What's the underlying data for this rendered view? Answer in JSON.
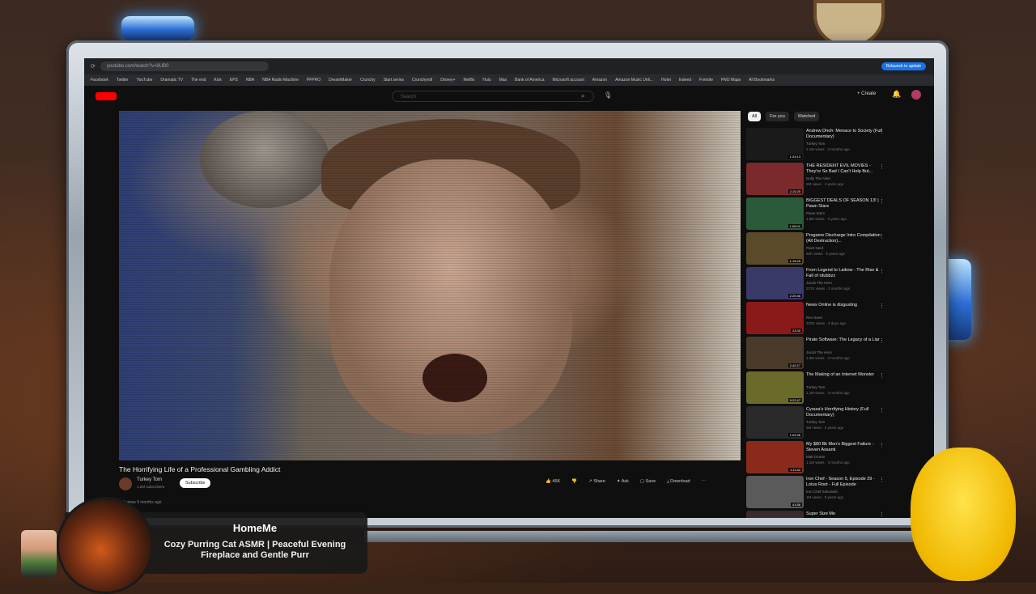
{
  "browser": {
    "url": "youtube.com/watch?v=8UB0",
    "relaunch_label": "Relaunch to update",
    "bookmarks": [
      "Facebook",
      "Twitter",
      "YouTube",
      "Dramatic TV",
      "The end",
      "Kick",
      "EPS",
      "NBA",
      "NBA Radio Machine",
      "PFPRO",
      "DreamMaker",
      "Crunchy",
      "Start series",
      "Crunchyroll",
      "Disney+",
      "Netflix",
      "Hulu",
      "Max",
      "Bank of America",
      "Microsoft account",
      "Amazon",
      "Amazon Music Unli...",
      "Hotel",
      "Indeed",
      "Fortnite",
      "FNO Maps",
      "All Bookmarks"
    ]
  },
  "youtube": {
    "search_placeholder": "Search",
    "create_label": "Create",
    "chips": [
      "All",
      "For you",
      "Watched"
    ],
    "video": {
      "title": "The Horrifying Life of a Professional Gambling Addict",
      "channel": "Turkey Tom",
      "subscribers": "1.2M subscribers",
      "subscribe_label": "Subscribe",
      "likes": "46K",
      "share_label": "Share",
      "ask_label": "Ask",
      "save_label": "Save",
      "download_label": "Download",
      "meta": "1M views  9 months ago"
    },
    "recommendations": [
      {
        "title": "Andrew Dhoh: Menace to Society (Full Documentary)",
        "channel": "Turkey Tom",
        "meta": "2.1M views · 3 months ago",
        "duration": "1:24:13",
        "color": "#1a1a1a"
      },
      {
        "title": "THE RESIDENT EVIL MOVIES - They're So Bad I Can't Help But...",
        "channel": "Dolly The Alien",
        "meta": "2M views · 4 years ago",
        "duration": "2:10:25",
        "color": "#7a2a2a"
      },
      {
        "title": "BIGGEST DEALS OF SEASON 13! | Pawn Stars",
        "channel": "Pawn Stars",
        "meta": "1.8M views · 3 years ago",
        "duration": "1:05:01",
        "color": "#2a5a3a"
      },
      {
        "title": "Progame Discharge Intro Compilation (All Destruction)...",
        "channel": "Paint Nerd",
        "meta": "50K views · 5 years ago",
        "duration": "1:15:25",
        "color": "#5a4a2a"
      },
      {
        "title": "From Legend to Laikow - The Rise & Fall of rdubbzz",
        "channel": "Jacob The Hero",
        "meta": "227K views · 2 months ago",
        "duration": "2:20:46",
        "color": "#3a3a6a"
      },
      {
        "title": "News Online is disgusting",
        "channel": "Rev Seed",
        "meta": "220K views · 3 days ago",
        "duration": "23:30",
        "color": "#8a1a1a"
      },
      {
        "title": "Pirate Software: The Legacy of a Liar",
        "channel": "Jacob The Hero",
        "meta": "1.8M views · 4 months ago",
        "duration": "2:42:27",
        "color": "#4a3a2a"
      },
      {
        "title": "The Making of an Internet Monster",
        "channel": "Turkey Tom",
        "meta": "1.1M views · 3 months ago",
        "duration": "5:22:47",
        "color": "#6a6a2a"
      },
      {
        "title": "Cyrasa's Horrifying History (Full Documentary)",
        "channel": "Turkey Tom",
        "meta": "3M views · 2 years ago",
        "duration": "1:09:36",
        "color": "#2a2a2a"
      },
      {
        "title": "My $80 Bk Men's Biggest Failure - Steven Assanti",
        "channel": "Matt Ocean",
        "meta": "1.1M views · 3 months ago",
        "duration": "1:11:52",
        "color": "#8a2a1a"
      },
      {
        "title": "Iron Chef - Season 5, Episode 29 - Lotus Root - Full Episode",
        "channel": "Iron Chef Sokowski",
        "meta": "1M views · 5 years ago",
        "duration": "41:56",
        "color": "#5a5a5a"
      },
      {
        "title": "Super Size Me",
        "channel": "",
        "meta": "",
        "duration": "",
        "color": "#3a2a2a"
      }
    ]
  },
  "overlay": {
    "channel": "HomeMe",
    "title": "Cozy Purring Cat ASMR | Peaceful Evening Fireplace and Gentle Purr"
  },
  "colors": {
    "youtube_red": "#ff0000",
    "frame_metal": "#9aa4ae",
    "lamp_blue": "#2d6fd6",
    "pacman_yellow": "#ffe24a"
  }
}
